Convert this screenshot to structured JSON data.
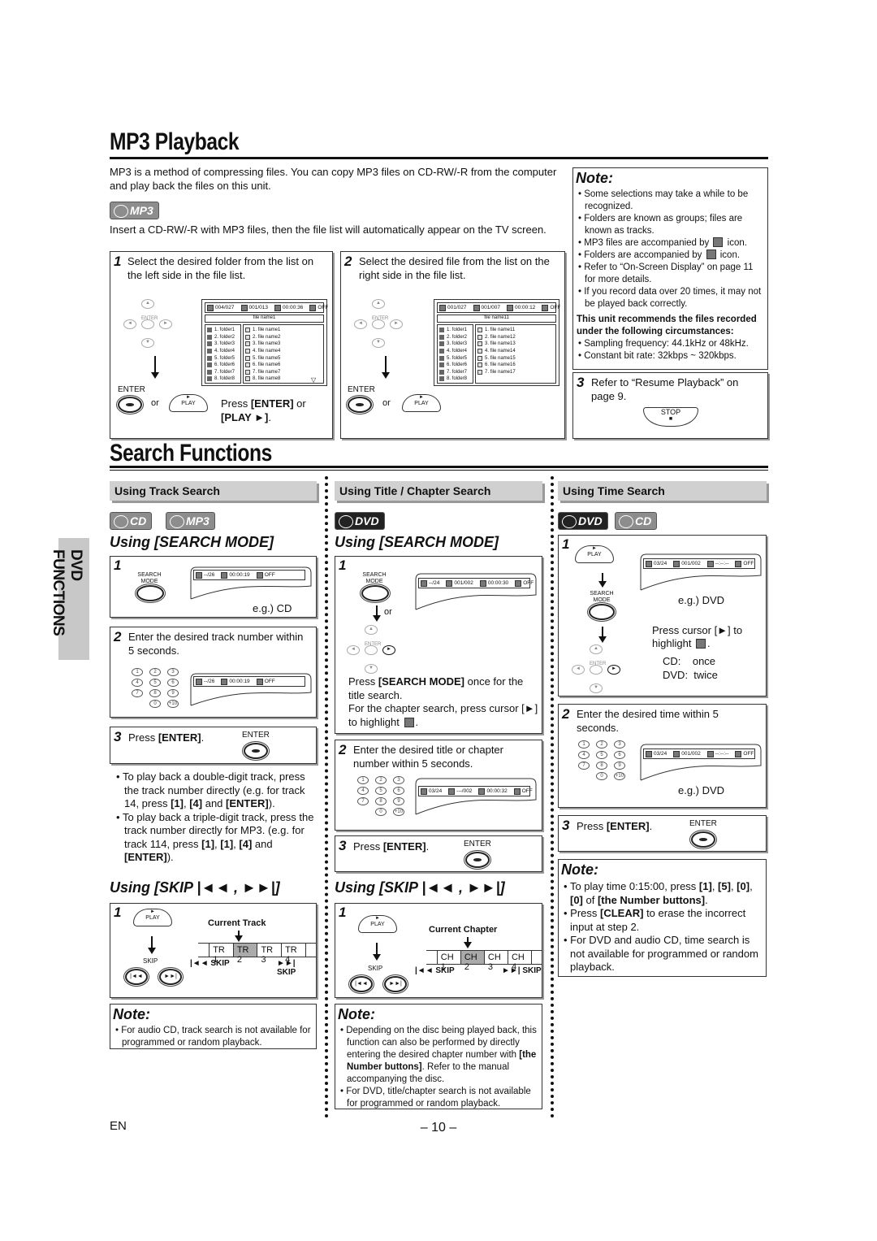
{
  "mp3": {
    "title": "MP3 Playback",
    "intro": "MP3 is a method of compressing files. You can copy MP3 files on CD-RW/-R from the computer and play back the files on this unit.",
    "badge": "MP3",
    "insert": "Insert a CD-RW/-R with MP3 files, then the file list will automatically appear on the TV screen.",
    "step1": {
      "num": "1",
      "text": "Select the desired folder from the list on the left side in the file list.",
      "osd": [
        {
          "icon": "folder",
          "text": "004/027"
        },
        {
          "icon": "file",
          "text": "001/013"
        },
        {
          "icon": "clock",
          "text": "00:00:36"
        },
        {
          "icon": "repeat",
          "text": "OFF"
        }
      ],
      "filename": "file name1",
      "folders": [
        "1.  folder1",
        "2.  folder2",
        "3.  folder3",
        "4.  folder4",
        "5.  folder5",
        "6.  folder6",
        "7.  folder7",
        "8.  folder8"
      ],
      "files": [
        "1.  file name1",
        "2.  file name2",
        "3.  file name3",
        "4.  file name4",
        "5.  file name5",
        "6.  file name6",
        "7.  file name7",
        "8.  file name8"
      ],
      "press": [
        [
          "Press ",
          false
        ],
        [
          "[ENTER]",
          true
        ],
        [
          " or ",
          false
        ],
        [
          "[PLAY ►]",
          true
        ],
        [
          ".",
          false
        ]
      ]
    },
    "step2": {
      "num": "2",
      "text": "Select the desired file from the list on the right side in the file list.",
      "osd": [
        {
          "icon": "folder",
          "text": "001/027"
        },
        {
          "icon": "file",
          "text": "001/007"
        },
        {
          "icon": "clock",
          "text": "00:00:12"
        },
        {
          "icon": "repeat",
          "text": "OFF"
        }
      ],
      "filename": "file name11",
      "folders": [
        "1.  folder1",
        "2.  folder2",
        "3.  folder3",
        "4.  folder4",
        "5.  folder5",
        "6.  folder6",
        "7.  folder7",
        "8.  folder8"
      ],
      "files": [
        "1.  file name11",
        "2.  file name12",
        "3.  file name13",
        "4.  file name14",
        "5.  file name15",
        "6.  file name16",
        "7.  file name17"
      ]
    },
    "note": {
      "title": "Note:",
      "items": [
        [
          [
            "Some selections may take a while to be recognized.",
            false
          ]
        ],
        [
          [
            "Folders are known as groups; files are known as tracks.",
            false
          ]
        ],
        [
          [
            "MP3 files are accompanied by ",
            false
          ],
          {
            "icon": "mp3-file"
          },
          [
            " icon.",
            false
          ]
        ],
        [
          [
            "Folders are accompanied by ",
            false
          ],
          {
            "icon": "folder"
          },
          [
            " icon.",
            false
          ]
        ],
        [
          [
            "Refer to “On-Screen Display” on page 11 for more details.",
            false
          ]
        ],
        [
          [
            "If you record data over 20 times, it may not be played back correctly.",
            false
          ]
        ]
      ],
      "recommend": "This unit recommends the files recorded under the following circumstances:",
      "items2": [
        [
          [
            "Sampling frequency: 44.1kHz or 48kHz.",
            false
          ]
        ],
        [
          [
            "Constant bit rate: 32kbps ~ 320kbps.",
            false
          ]
        ]
      ]
    },
    "step3": {
      "num": "3",
      "text": "Refer to “Resume Playback” on page 9.",
      "stop": "STOP"
    }
  },
  "labels": {
    "enter": "ENTER",
    "or": "or",
    "play": "PLAY",
    "search_mode": "SEARCH MODE",
    "skip": "SKIP",
    "skip_prev": "|◄◄ SKIP",
    "skip_next": "►►| SKIP"
  },
  "keypad": [
    "1",
    "2",
    "3",
    "4",
    "5",
    "6",
    "7",
    "8",
    "9",
    "0",
    "+10"
  ],
  "search": {
    "title": "Search Functions",
    "side_tab": "DVD FUNCTIONS",
    "track": {
      "header": "Using Track Search",
      "badges": [
        "CD",
        "MP3"
      ],
      "using_search": "Using [SEARCH MODE]",
      "step1": {
        "num": "1",
        "osd": [
          {
            "icon": "track",
            "text": "--/26"
          },
          {
            "icon": "clock",
            "text": "00:00:19"
          },
          {
            "icon": "repeat",
            "text": "OFF"
          }
        ],
        "eg": "e.g.) CD"
      },
      "step2": {
        "num": "2",
        "text": "Enter the desired track number within 5 seconds.",
        "osd": [
          {
            "icon": "track",
            "text": "--/26"
          },
          {
            "icon": "clock",
            "text": "00:00:19"
          },
          {
            "icon": "repeat",
            "text": "OFF"
          }
        ]
      },
      "step3": {
        "num": "3",
        "text": [
          [
            "Press ",
            false
          ],
          [
            "[ENTER]",
            true
          ],
          [
            ".",
            false
          ]
        ]
      },
      "bullets": [
        [
          [
            "To play back a double-digit track, press the track number directly (e.g. for track 14, press ",
            false
          ],
          [
            "[1]",
            true
          ],
          [
            ", ",
            false
          ],
          [
            "[4]",
            true
          ],
          [
            " and ",
            false
          ],
          [
            "[ENTER]",
            true
          ],
          [
            ").",
            false
          ]
        ],
        [
          [
            "To play back a triple-digit track, press the track number directly for MP3. (e.g. for track 114, press ",
            false
          ],
          [
            "[1]",
            true
          ],
          [
            ", ",
            false
          ],
          [
            "[1]",
            true
          ],
          [
            ", ",
            false
          ],
          [
            "[4]",
            true
          ],
          [
            " and ",
            false
          ],
          [
            "[ENTER]",
            true
          ],
          [
            ").",
            false
          ]
        ]
      ],
      "using_skip": "Using [SKIP |◄◄ , ►►|]",
      "skip": {
        "num": "1",
        "current": "Current Track",
        "cells": [
          "TR 1",
          "TR 2",
          "TR 3",
          "TR 4"
        ],
        "current_index": 1
      },
      "note": {
        "title": "Note:",
        "items": [
          [
            [
              "For audio CD, track search is not available for programmed or random playback.",
              false
            ]
          ]
        ]
      }
    },
    "title_chapter": {
      "header": "Using Title / Chapter Search",
      "badges": [
        "DVD"
      ],
      "using_search": "Using [SEARCH MODE]",
      "step1": {
        "num": "1",
        "osd": [
          {
            "icon": "title",
            "text": "--/24"
          },
          {
            "icon": "chapter",
            "text": "001/002"
          },
          {
            "icon": "clock",
            "text": "00:00:30"
          },
          {
            "icon": "repeat",
            "text": "OFF"
          }
        ],
        "text": [
          [
            "Press ",
            false
          ],
          [
            "[SEARCH MODE]",
            true
          ],
          [
            " once for the title search.",
            false
          ]
        ],
        "text2": [
          [
            "For the chapter search, press cursor [►] to highlight ",
            false
          ],
          {
            "icon": "chapter"
          },
          [
            ".",
            false
          ]
        ]
      },
      "step2": {
        "num": "2",
        "text": "Enter the desired title or chapter number within 5 seconds.",
        "osd": [
          {
            "icon": "title",
            "text": "03/24"
          },
          {
            "icon": "chapter",
            "text": "---/002"
          },
          {
            "icon": "clock",
            "text": "00:00:32"
          },
          {
            "icon": "repeat",
            "text": "OFF"
          }
        ]
      },
      "step3": {
        "num": "3",
        "text": [
          [
            "Press ",
            false
          ],
          [
            "[ENTER]",
            true
          ],
          [
            ".",
            false
          ]
        ]
      },
      "using_skip": "Using [SKIP |◄◄ , ►►|]",
      "skip": {
        "num": "1",
        "current": "Current Chapter",
        "cells": [
          "CH 1",
          "CH 2",
          "CH 3",
          "CH 4"
        ],
        "current_index": 1
      },
      "note": {
        "title": "Note:",
        "items": [
          [
            [
              "Depending on the disc being played back, this function can also be performed by directly entering the desired chapter number with ",
              false
            ],
            [
              "[the Number buttons]",
              true
            ],
            [
              ". Refer to the manual accompanying the disc.",
              false
            ]
          ],
          [
            [
              "For DVD, title/chapter search is not available for programmed or random playback.",
              false
            ]
          ]
        ]
      }
    },
    "time": {
      "header": "Using Time Search",
      "badges": [
        "DVD",
        "CD"
      ],
      "step1": {
        "num": "1",
        "osd": [
          {
            "icon": "title",
            "text": "03/24"
          },
          {
            "icon": "chapter",
            "text": "001/002"
          },
          {
            "icon": "clock",
            "text": "--:--:--"
          },
          {
            "icon": "repeat",
            "text": "OFF"
          }
        ],
        "eg": "e.g.) DVD",
        "text": [
          [
            "Press cursor [►] to",
            false
          ]
        ],
        "text2": [
          [
            "highlight ",
            false
          ],
          {
            "icon": "clock"
          },
          [
            ".",
            false
          ]
        ],
        "cd": "CD:    once",
        "dvd": "DVD:  twice"
      },
      "step2": {
        "num": "2",
        "text": "Enter the desired time within 5 seconds.",
        "osd": [
          {
            "icon": "title",
            "text": "03/24"
          },
          {
            "icon": "chapter",
            "text": "001/002"
          },
          {
            "icon": "clock",
            "text": "--:--:--"
          },
          {
            "icon": "repeat",
            "text": "OFF"
          }
        ],
        "eg": "e.g.) DVD"
      },
      "step3": {
        "num": "3",
        "text": [
          [
            "Press ",
            false
          ],
          [
            "[ENTER]",
            true
          ],
          [
            ".",
            false
          ]
        ]
      },
      "note": {
        "title": "Note:",
        "items": [
          [
            [
              "To play time 0:15:00, press ",
              false
            ],
            [
              "[1]",
              true
            ],
            [
              ", ",
              false
            ],
            [
              "[5]",
              true
            ],
            [
              ", ",
              false
            ],
            [
              "[0]",
              true
            ],
            [
              ", ",
              false
            ],
            [
              "[0]",
              true
            ],
            [
              " of ",
              false
            ],
            [
              "[the Number buttons]",
              true
            ],
            [
              ".",
              false
            ]
          ],
          [
            [
              "Press ",
              false
            ],
            [
              "[CLEAR]",
              true
            ],
            [
              " to erase the incorrect input at step 2.",
              false
            ]
          ],
          [
            [
              "For DVD and audio CD, time search is not available for programmed or random playback.",
              false
            ]
          ]
        ]
      }
    }
  },
  "footer": {
    "lang": "EN",
    "page": "– 10 –"
  }
}
